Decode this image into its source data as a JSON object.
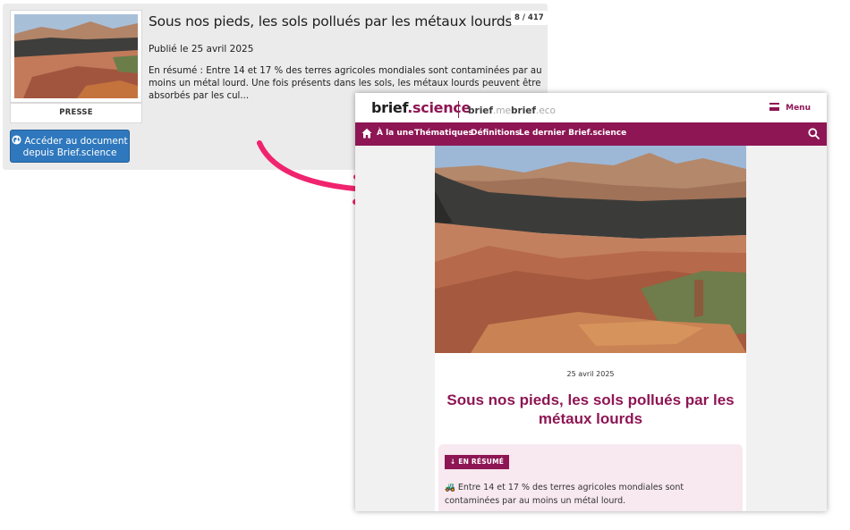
{
  "card": {
    "counter": "8 / 417",
    "title": "Sous nos pieds, les sols pollués par les métaux lourds",
    "date": "Publié le 25 avril 2025",
    "summary": "En résumé : Entre 14 et 17 % des terres agricoles mondiales sont contaminées par au moins un métal lourd. Une fois présents dans les sols, les métaux lourds peuvent être absorbés par les cul...",
    "tag": "PRESSE",
    "button_line1": "Accéder au document",
    "button_line2": "depuis Brief.science"
  },
  "site": {
    "logo_main": "brief",
    "logo_accent": ".science",
    "sister1_main": "brief",
    "sister1_light": ".me",
    "sister2_main": "brief",
    "sister2_light": ".eco",
    "menu_label": "Menu",
    "nav": [
      "À la une",
      "Thématiques",
      "Définitions",
      "Le dernier Brief.science"
    ],
    "article_date": "25 avril 2025",
    "article_title": "Sous nos pieds, les sols pollués par les métaux lourds",
    "summary_badge": "EN RÉSUMÉ",
    "summary_text": "🚜 Entre 14 et 17 % des terres agricoles mondiales sont contaminées par au moins un métal lourd."
  },
  "colors": {
    "brand": "#8e1654",
    "button_blue": "#2f78bd",
    "arrow_pink": "#f0246e"
  }
}
